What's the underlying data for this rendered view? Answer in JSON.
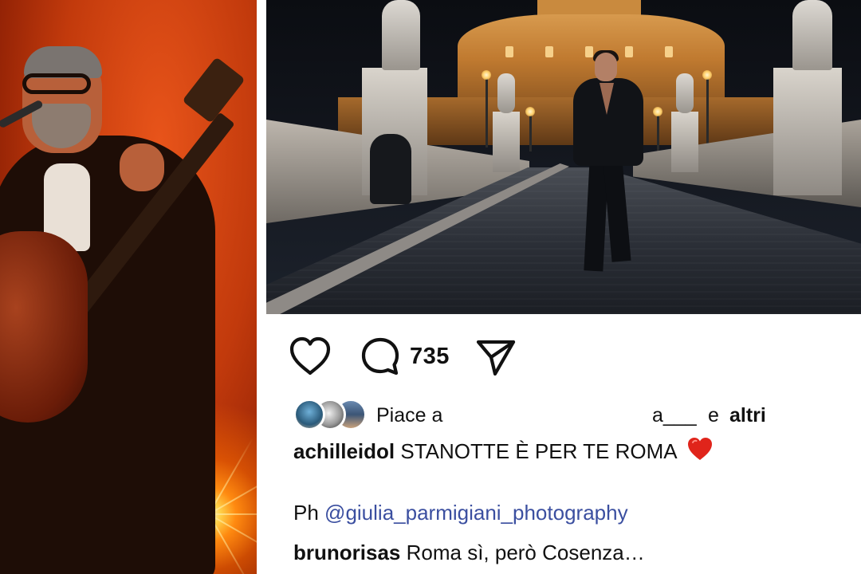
{
  "post": {
    "comment_count": "735",
    "likes": {
      "prefix": "Piace a",
      "redacted_tail": "a___",
      "conjunction": "e",
      "others": "altri"
    },
    "caption": {
      "username": "achilleidol",
      "text": "STANOTTE È PER TE ROMA"
    },
    "credit": {
      "prefix": "Ph",
      "mention": "@giulia_parmigiani_photography"
    },
    "comment": {
      "username": "brunorisas",
      "text": "Roma sì, però Cosenza…"
    }
  },
  "icons": {
    "like": "heart-outline-icon",
    "comment": "comment-bubble-icon",
    "share": "paper-plane-icon",
    "caption_emoji": "red-heart-emoji"
  },
  "colors": {
    "mention": "#3b4fa0",
    "heart_emoji": "#e0241b",
    "text": "#111111"
  }
}
